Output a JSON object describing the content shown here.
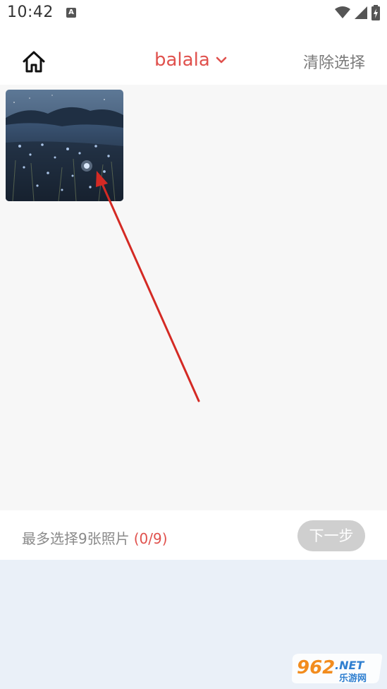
{
  "status_bar": {
    "time": "10:42",
    "notification_glyph": "A",
    "icons": [
      "wifi-icon",
      "signal-icon",
      "battery-icon"
    ]
  },
  "header": {
    "home_icon": "home-icon",
    "album_name": "balala",
    "dropdown_icon": "chevron-down-icon",
    "clear_label": "清除选择"
  },
  "grid": {
    "photos": [
      {
        "name": "night-meadow-photo",
        "selected": false
      }
    ]
  },
  "footer": {
    "max_tip": "最多选择9张照片",
    "selection_count": "(0/9)",
    "next_label": "下一步"
  },
  "watermark": {
    "brand": "962",
    "suffix": ".NET",
    "subtitle": "乐游网"
  },
  "colors": {
    "accent": "#e0514d",
    "disabled_button": "#cfcfcf",
    "annotation_arrow": "#d42a24"
  }
}
